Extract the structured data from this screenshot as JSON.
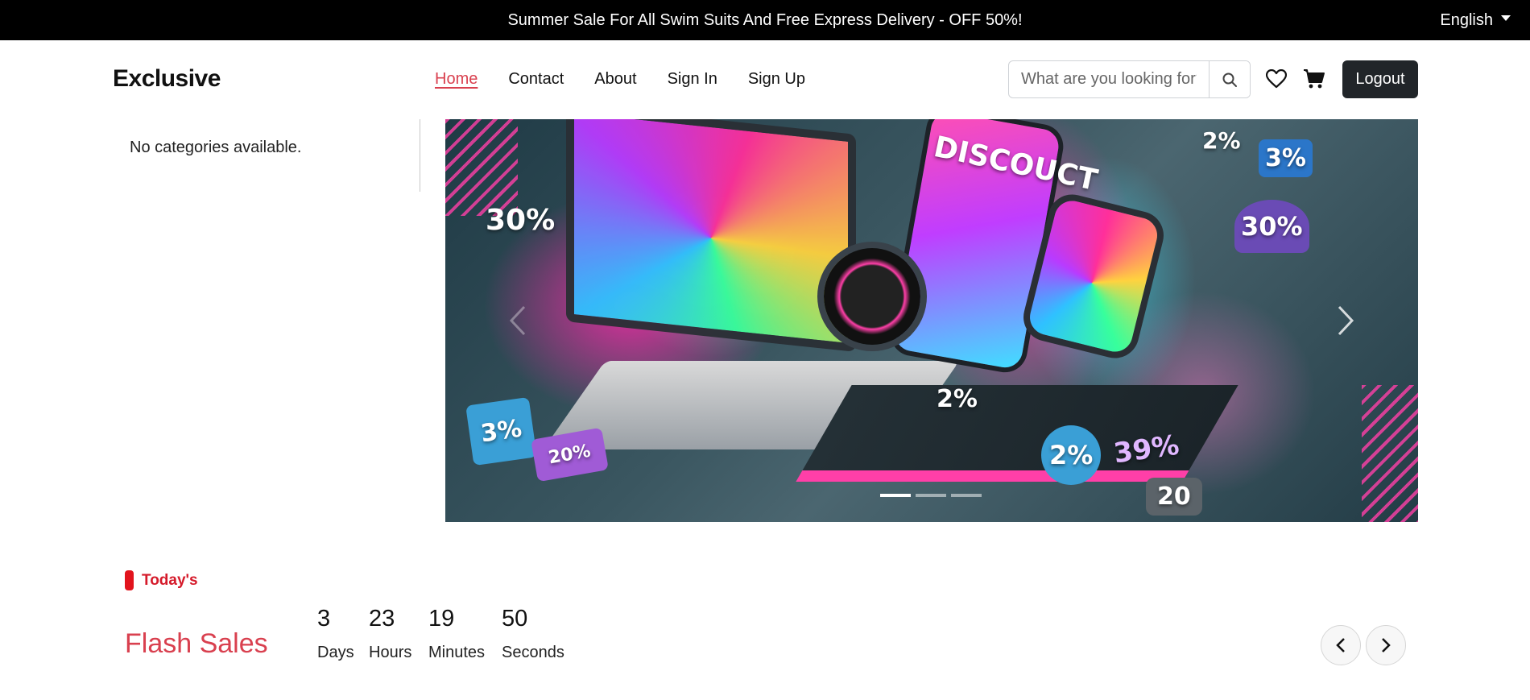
{
  "topbar": {
    "promo": "Summer Sale For All Swim Suits And Free Express Delivery - OFF 50%!",
    "language": "English"
  },
  "header": {
    "logo": "Exclusive",
    "nav": [
      {
        "label": "Home",
        "active": true
      },
      {
        "label": "Contact",
        "active": false
      },
      {
        "label": "About",
        "active": false
      },
      {
        "label": "Sign In",
        "active": false
      },
      {
        "label": "Sign Up",
        "active": false
      }
    ],
    "search": {
      "placeholder": "What are you looking for?",
      "value": ""
    },
    "icons": {
      "search": "search-icon",
      "wishlist": "heart-icon",
      "cart": "cart-icon"
    },
    "logout_label": "Logout"
  },
  "sidebar": {
    "empty_text": "No categories available."
  },
  "hero": {
    "tags": [
      "30%",
      "3%",
      "20%",
      "2%",
      "3%",
      "30%",
      "DISCOUCT",
      "2%",
      "2%",
      "39%",
      "20"
    ],
    "slides_total": 3,
    "active_slide": 1
  },
  "flash_sales": {
    "section_label": "Today's",
    "title": "Flash Sales",
    "countdown": [
      {
        "value": "3",
        "unit": "Days"
      },
      {
        "value": "23",
        "unit": "Hours"
      },
      {
        "value": "19",
        "unit": "Minutes"
      },
      {
        "value": "50",
        "unit": "Seconds"
      }
    ]
  },
  "colors": {
    "accent": "#d9404f",
    "section_bar": "#e2141d",
    "topbar_bg": "#000000",
    "logout_bg": "#212529"
  }
}
